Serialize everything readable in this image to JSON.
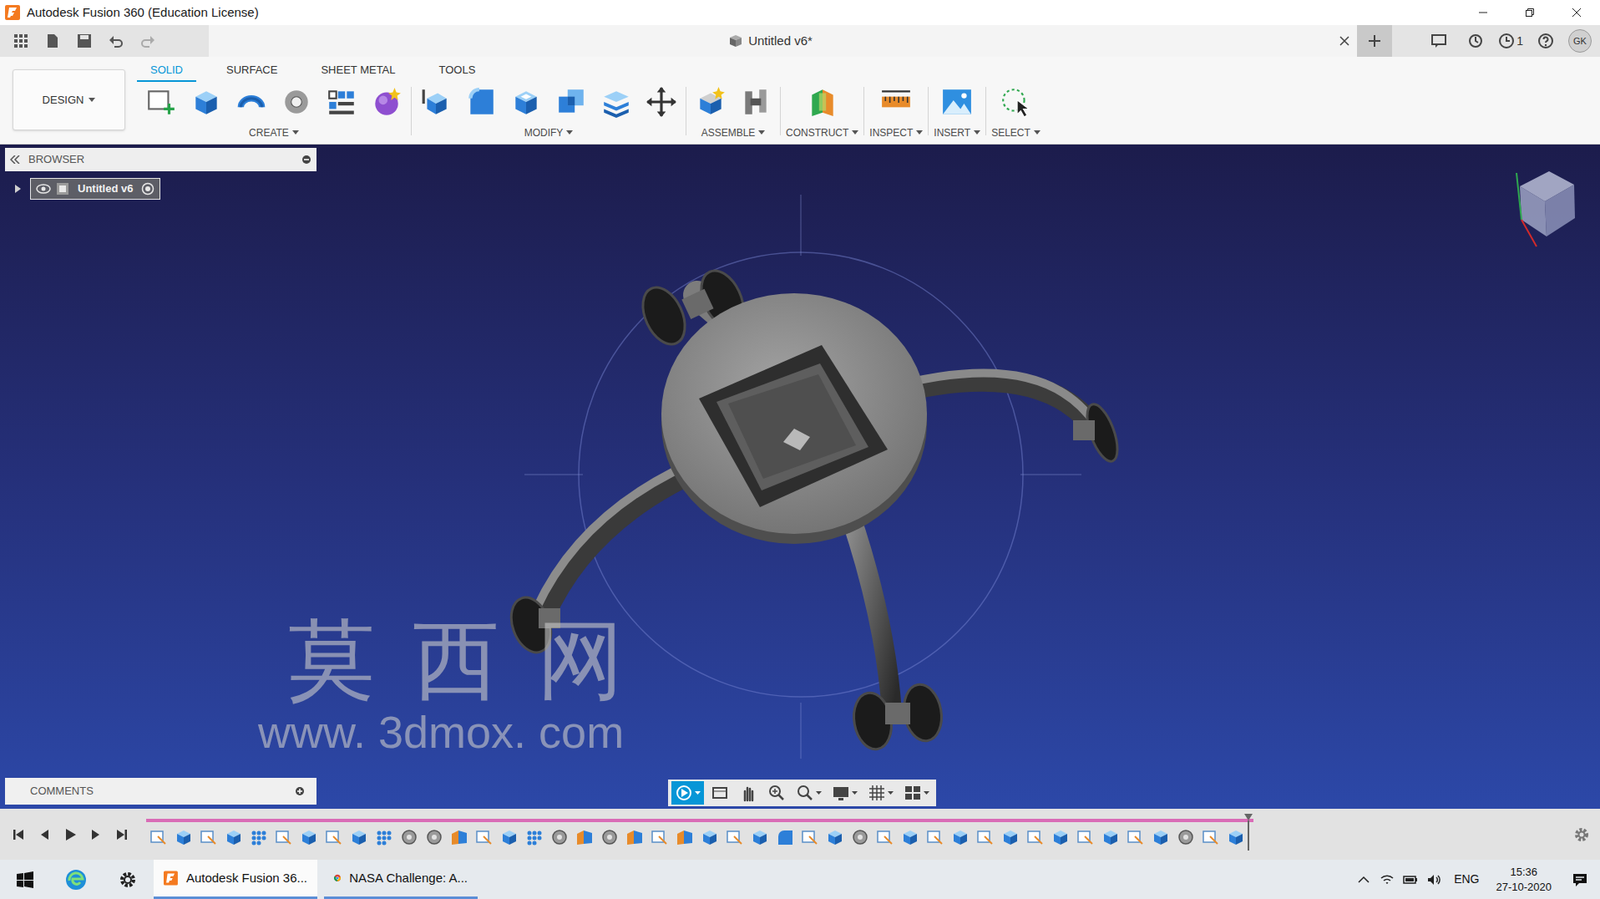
{
  "window": {
    "title": "Autodesk Fusion 360 (Education License)"
  },
  "document_tab": {
    "title": "Untitled v6*"
  },
  "quick_access": {
    "jobs_count": "1",
    "user_initials": "GK"
  },
  "workspace": {
    "label": "DESIGN"
  },
  "ribbon_tabs": [
    {
      "label": "SOLID",
      "selected": true
    },
    {
      "label": "SURFACE",
      "selected": false
    },
    {
      "label": "SHEET METAL",
      "selected": false
    },
    {
      "label": "TOOLS",
      "selected": false
    }
  ],
  "ribbon_groups": [
    {
      "label": "CREATE"
    },
    {
      "label": "MODIFY"
    },
    {
      "label": "ASSEMBLE"
    },
    {
      "label": "CONSTRUCT"
    },
    {
      "label": "INSPECT"
    },
    {
      "label": "INSERT"
    },
    {
      "label": "SELECT"
    }
  ],
  "browser": {
    "title": "BROWSER",
    "items": [
      {
        "label": "Untitled v6",
        "expanded": false,
        "visible": true,
        "selected": true
      }
    ]
  },
  "comments": {
    "title": "COMMENTS"
  },
  "watermark": {
    "title": "莫 西 网",
    "url": "www. 3dmox. com"
  },
  "timeline": {
    "features": [
      {
        "kind": "sketch"
      },
      {
        "kind": "extrude"
      },
      {
        "kind": "sketch"
      },
      {
        "kind": "extrude"
      },
      {
        "kind": "pattern"
      },
      {
        "kind": "sketch"
      },
      {
        "kind": "extrude"
      },
      {
        "kind": "sketch"
      },
      {
        "kind": "extrude"
      },
      {
        "kind": "pattern"
      },
      {
        "kind": "combine"
      },
      {
        "kind": "combine"
      },
      {
        "kind": "plane"
      },
      {
        "kind": "sketch"
      },
      {
        "kind": "extrude"
      },
      {
        "kind": "pattern"
      },
      {
        "kind": "combine"
      },
      {
        "kind": "plane"
      },
      {
        "kind": "combine"
      },
      {
        "kind": "plane"
      },
      {
        "kind": "sketch"
      },
      {
        "kind": "plane"
      },
      {
        "kind": "extrude"
      },
      {
        "kind": "sketch"
      },
      {
        "kind": "extrude"
      },
      {
        "kind": "fillet"
      },
      {
        "kind": "sketch"
      },
      {
        "kind": "extrude"
      },
      {
        "kind": "combine"
      },
      {
        "kind": "sketch"
      },
      {
        "kind": "extrude"
      },
      {
        "kind": "sketch"
      },
      {
        "kind": "extrude"
      },
      {
        "kind": "sketch"
      },
      {
        "kind": "extrude"
      },
      {
        "kind": "sketch"
      },
      {
        "kind": "extrude"
      },
      {
        "kind": "sketch"
      },
      {
        "kind": "extrude"
      },
      {
        "kind": "sketch"
      },
      {
        "kind": "extrude"
      },
      {
        "kind": "combine"
      },
      {
        "kind": "sketch"
      },
      {
        "kind": "extrude"
      }
    ],
    "marker_level": 1
  },
  "taskbar": {
    "apps": [
      {
        "label": "Autodesk Fusion 36...",
        "selected": true
      },
      {
        "label": "NASA Challenge: A...",
        "selected": false
      }
    ],
    "tray": {
      "language": "ENG",
      "time": "15:36",
      "date": "27-10-2020"
    }
  }
}
